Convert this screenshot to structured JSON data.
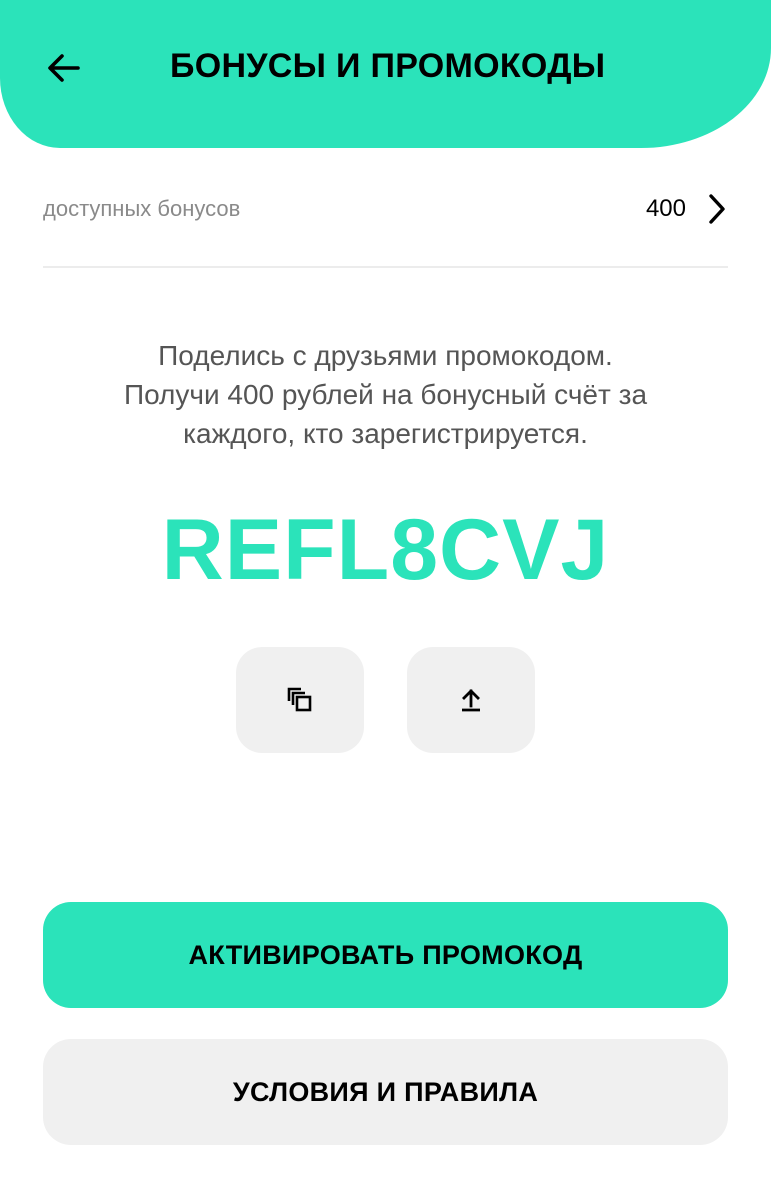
{
  "header": {
    "title": "БОНУСЫ И ПРОМОКОДЫ",
    "back_icon": "arrow-left-icon"
  },
  "bonus": {
    "label": "доступных бонусов",
    "value": "400",
    "chevron_icon": "chevron-right-icon"
  },
  "description": {
    "line1": "Поделись с друзьями промокодом.",
    "line2": "Получи 400 рублей на бонусный счёт за",
    "line3": "каждого, кто зарегистрируется."
  },
  "promo_code": "REFL8CVJ",
  "actions": {
    "copy_icon": "copy-icon",
    "share_icon": "share-upload-icon"
  },
  "buttons": {
    "activate": "АКТИВИРОВАТЬ ПРОМОКОД",
    "rules": "УСЛОВИЯ И ПРАВИЛА"
  },
  "colors": {
    "accent": "#2BE3BA",
    "secondary_button_bg": "#F0F0F0",
    "muted_text": "#8A8A8A"
  }
}
